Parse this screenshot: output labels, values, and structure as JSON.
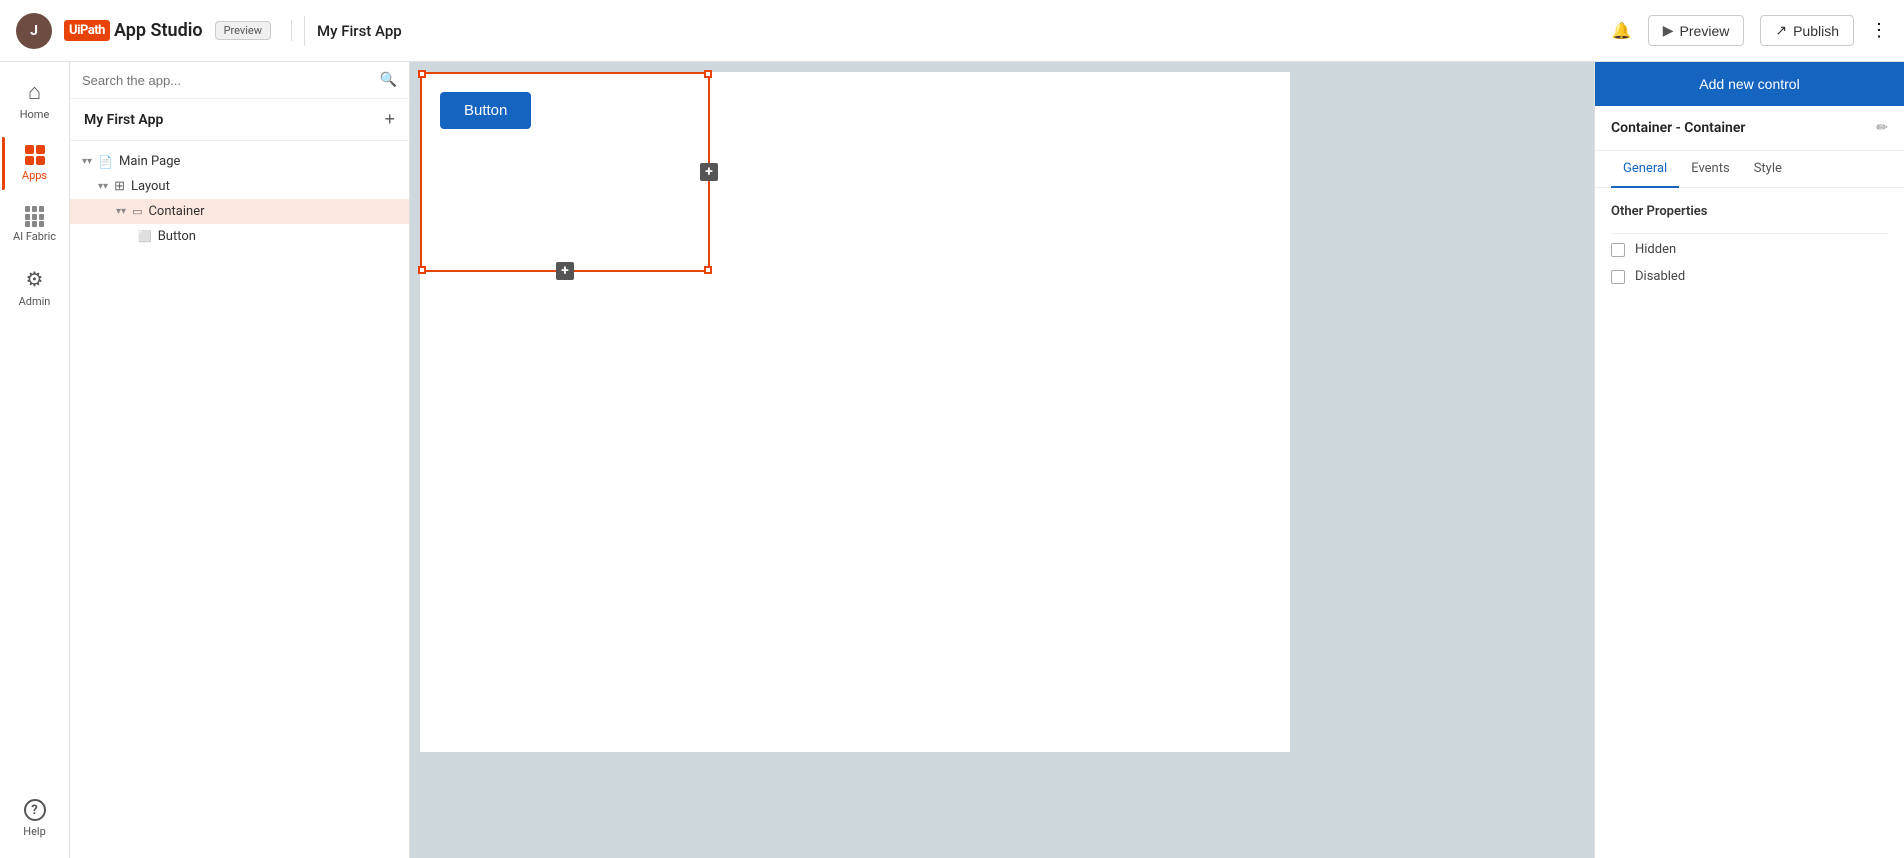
{
  "header": {
    "logo_bracket": "Ui",
    "logo_path": "Path",
    "app_studio": "App Studio",
    "preview_badge": "Preview",
    "app_name": "My First App",
    "preview_btn": "Preview",
    "publish_btn": "Publish"
  },
  "icon_sidebar": {
    "items": [
      {
        "id": "home",
        "label": "Home",
        "active": false
      },
      {
        "id": "apps",
        "label": "Apps",
        "active": true
      },
      {
        "id": "ai-fabric",
        "label": "AI Fabric",
        "active": false
      },
      {
        "id": "admin",
        "label": "Admin",
        "active": false
      },
      {
        "id": "help",
        "label": "Help",
        "active": false
      }
    ]
  },
  "tree_panel": {
    "search_placeholder": "Search the app...",
    "app_name": "My First App",
    "tree_items": [
      {
        "id": "main-page",
        "label": "Main Page",
        "indent": 0,
        "type": "page",
        "expanded": true
      },
      {
        "id": "layout",
        "label": "Layout",
        "indent": 1,
        "type": "layout",
        "expanded": true
      },
      {
        "id": "container",
        "label": "Container",
        "indent": 2,
        "type": "container",
        "selected": true,
        "expanded": true
      },
      {
        "id": "button",
        "label": "Button",
        "indent": 3,
        "type": "button"
      }
    ]
  },
  "canvas": {
    "button_label": "Button"
  },
  "right_panel": {
    "add_control_btn": "Add new control",
    "section_title": "Container - Container",
    "tabs": [
      {
        "id": "general",
        "label": "General",
        "active": true
      },
      {
        "id": "events",
        "label": "Events",
        "active": false
      },
      {
        "id": "style",
        "label": "Style",
        "active": false
      }
    ],
    "other_properties_title": "Other Properties",
    "properties": [
      {
        "id": "hidden",
        "label": "Hidden",
        "checked": false
      },
      {
        "id": "disabled",
        "label": "Disabled",
        "checked": false
      }
    ]
  },
  "colors": {
    "accent": "#e8440a",
    "blue": "#1565c0",
    "active_bg": "#fde8e0"
  }
}
